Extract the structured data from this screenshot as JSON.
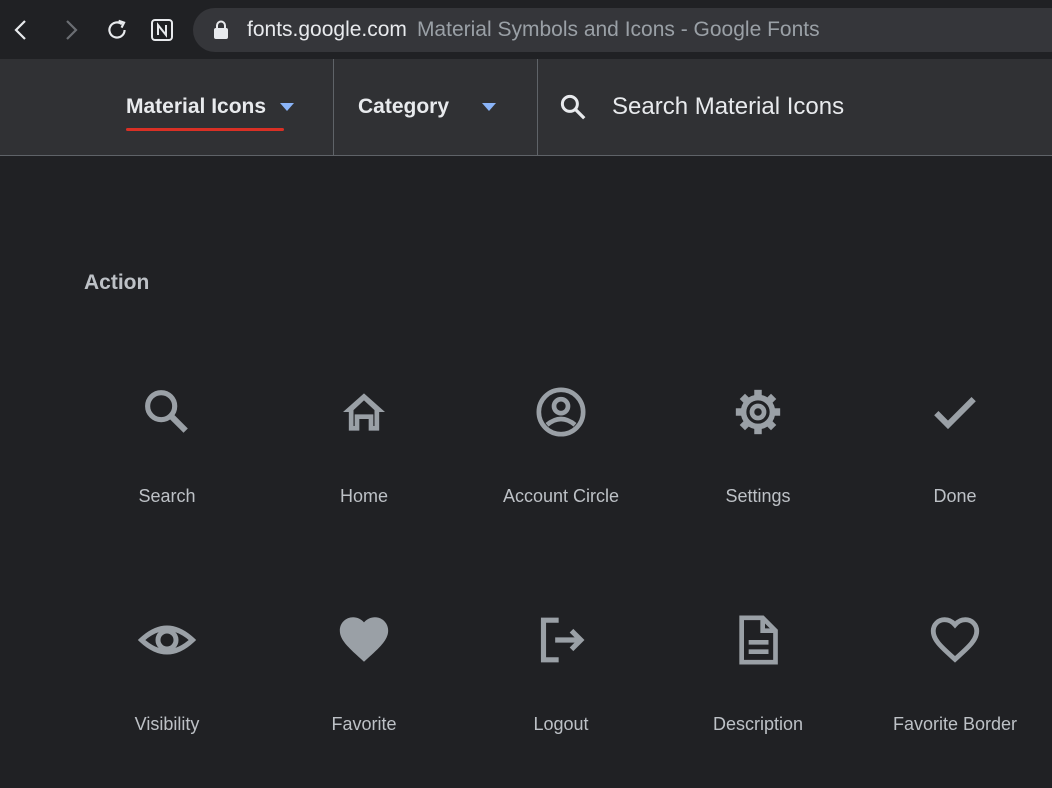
{
  "browser": {
    "url_host": "fonts.google.com",
    "page_title": "Material Symbols and Icons - Google Fonts",
    "icons": [
      "back-icon",
      "forward-icon",
      "reload-icon",
      "notion-icon",
      "lock-icon"
    ]
  },
  "toolbar": {
    "icon_set_label": "Material Icons",
    "category_label": "Category",
    "search_placeholder": "Search Material Icons",
    "accent_color": "#8ab4f8",
    "active_underline_color": "#d93025"
  },
  "section": {
    "title": "Action",
    "icons": [
      {
        "label": "Search",
        "icon": "search-icon"
      },
      {
        "label": "Home",
        "icon": "home-icon"
      },
      {
        "label": "Account Circle",
        "icon": "account-circle-icon"
      },
      {
        "label": "Settings",
        "icon": "settings-icon"
      },
      {
        "label": "Done",
        "icon": "done-icon"
      },
      {
        "label": "Visibility",
        "icon": "visibility-icon"
      },
      {
        "label": "Favorite",
        "icon": "favorite-icon"
      },
      {
        "label": "Logout",
        "icon": "logout-icon"
      },
      {
        "label": "Description",
        "icon": "description-icon"
      },
      {
        "label": "Favorite Border",
        "icon": "favorite-border-icon"
      }
    ]
  }
}
